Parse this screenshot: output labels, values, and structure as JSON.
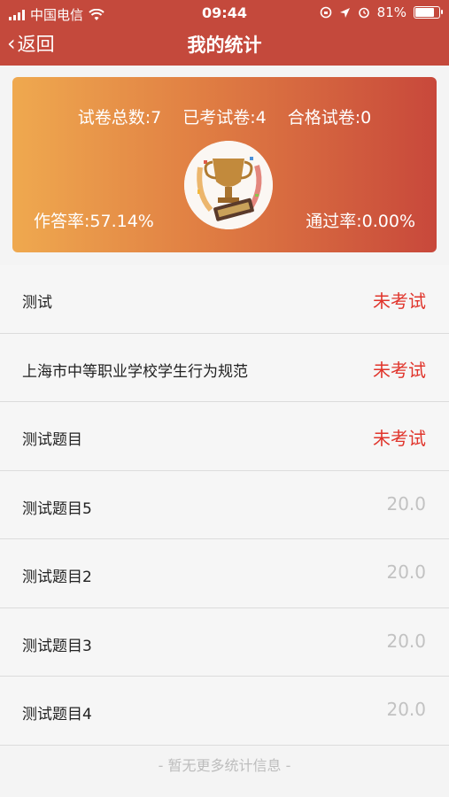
{
  "status_bar": {
    "carrier": "中国电信",
    "time": "09:44",
    "battery": "81%",
    "battery_level": 0.81
  },
  "nav": {
    "back_label": "返回",
    "title": "我的统计"
  },
  "summary": {
    "total_label": "试卷总数:7",
    "taken_label": "已考试卷:4",
    "passed_label": "合格试卷:0",
    "answer_rate_label": "作答率:57.14%",
    "pass_rate_label": "通过率:0.00%"
  },
  "rows": [
    {
      "name": "测试",
      "status": "未考试",
      "tone": "red"
    },
    {
      "name": "上海市中等职业学校学生行为规范",
      "status": "未考试",
      "tone": "red"
    },
    {
      "name": "测试题目",
      "status": "未考试",
      "tone": "red"
    },
    {
      "name": "测试题目5",
      "status": "20.0",
      "tone": "gray"
    },
    {
      "name": "测试题目2",
      "status": "20.0",
      "tone": "gray"
    },
    {
      "name": "测试题目3",
      "status": "20.0",
      "tone": "gray"
    },
    {
      "name": "测试题目4",
      "status": "20.0",
      "tone": "gray"
    }
  ],
  "footer": "- 暂无更多统计信息 -",
  "colors": {
    "header": "#c4493c",
    "status_red": "#e0342b",
    "score_gray": "#c2c2c2"
  }
}
